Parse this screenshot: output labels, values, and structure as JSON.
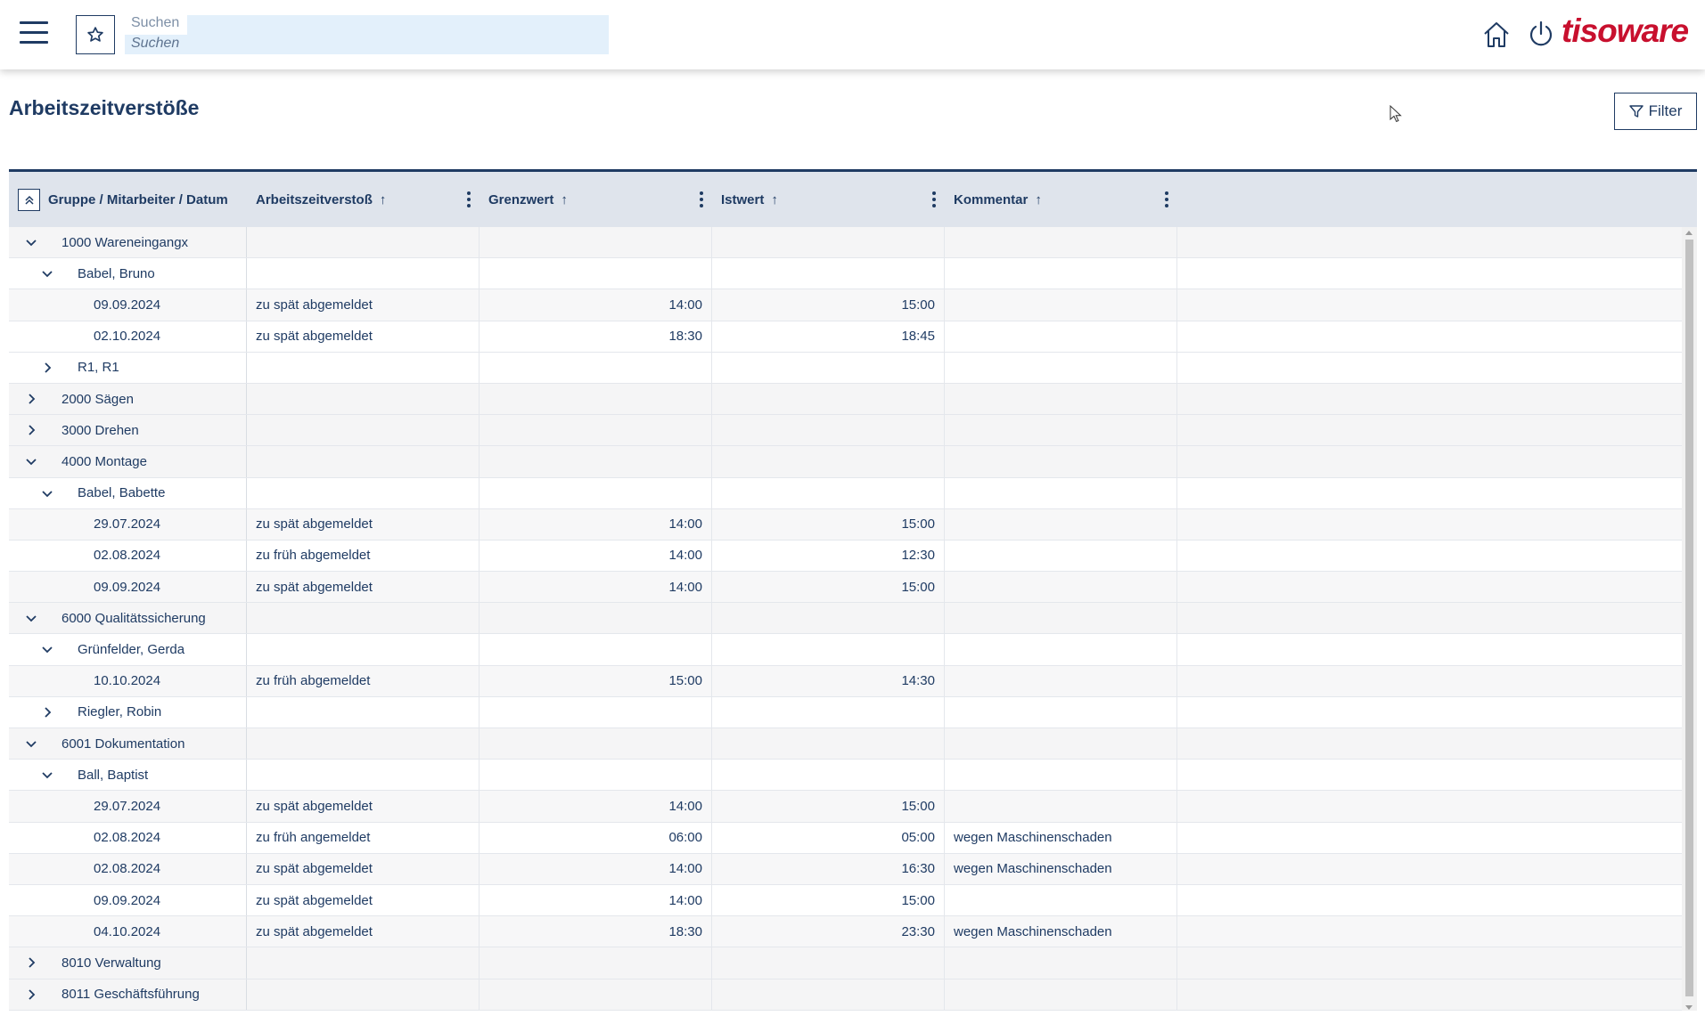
{
  "header": {
    "search_label": "Suchen",
    "search_placeholder": "Suchen",
    "logo": "tisoware",
    "menu_icon": "hamburger-icon",
    "favorite_icon": "star-icon",
    "home_icon": "home-icon",
    "power_icon": "power-icon"
  },
  "page": {
    "title": "Arbeitszeitverstöße",
    "filter_label": "Filter"
  },
  "table": {
    "columns": [
      {
        "label": "Gruppe / Mitarbeiter / Datum"
      },
      {
        "label": "Arbeitszeitverstoß"
      },
      {
        "label": "Grenzwert"
      },
      {
        "label": "Istwert"
      },
      {
        "label": "Kommentar"
      }
    ],
    "rows": [
      {
        "level": 0,
        "expanded": true,
        "label": "1000 Wareneingangx"
      },
      {
        "level": 1,
        "expanded": true,
        "label": "Babel, Bruno"
      },
      {
        "level": 2,
        "label": "09.09.2024",
        "violation": "zu spät abgemeldet",
        "limit": "14:00",
        "actual": "15:00",
        "comment": ""
      },
      {
        "level": 2,
        "label": "02.10.2024",
        "violation": "zu spät abgemeldet",
        "limit": "18:30",
        "actual": "18:45",
        "comment": ""
      },
      {
        "level": 1,
        "expanded": false,
        "label": "R1, R1"
      },
      {
        "level": 0,
        "expanded": false,
        "label": "2000 Sägen"
      },
      {
        "level": 0,
        "expanded": false,
        "label": "3000 Drehen"
      },
      {
        "level": 0,
        "expanded": true,
        "label": "4000 Montage"
      },
      {
        "level": 1,
        "expanded": true,
        "label": "Babel, Babette"
      },
      {
        "level": 2,
        "label": "29.07.2024",
        "violation": "zu spät abgemeldet",
        "limit": "14:00",
        "actual": "15:00",
        "comment": ""
      },
      {
        "level": 2,
        "label": "02.08.2024",
        "violation": "zu früh abgemeldet",
        "limit": "14:00",
        "actual": "12:30",
        "comment": ""
      },
      {
        "level": 2,
        "label": "09.09.2024",
        "violation": "zu spät abgemeldet",
        "limit": "14:00",
        "actual": "15:00",
        "comment": ""
      },
      {
        "level": 0,
        "expanded": true,
        "label": "6000 Qualitätssicherung"
      },
      {
        "level": 1,
        "expanded": true,
        "label": "Grünfelder, Gerda"
      },
      {
        "level": 2,
        "label": "10.10.2024",
        "violation": "zu früh abgemeldet",
        "limit": "15:00",
        "actual": "14:30",
        "comment": ""
      },
      {
        "level": 1,
        "expanded": false,
        "label": "Riegler, Robin"
      },
      {
        "level": 0,
        "expanded": true,
        "label": "6001 Dokumentation"
      },
      {
        "level": 1,
        "expanded": true,
        "label": "Ball, Baptist"
      },
      {
        "level": 2,
        "label": "29.07.2024",
        "violation": "zu spät abgemeldet",
        "limit": "14:00",
        "actual": "15:00",
        "comment": ""
      },
      {
        "level": 2,
        "label": "02.08.2024",
        "violation": "zu früh angemeldet",
        "limit": "06:00",
        "actual": "05:00",
        "comment": "wegen Maschinenschaden"
      },
      {
        "level": 2,
        "label": "02.08.2024",
        "violation": "zu spät abgemeldet",
        "limit": "14:00",
        "actual": "16:30",
        "comment": "wegen Maschinenschaden"
      },
      {
        "level": 2,
        "label": "09.09.2024",
        "violation": "zu spät abgemeldet",
        "limit": "14:00",
        "actual": "15:00",
        "comment": ""
      },
      {
        "level": 2,
        "label": "04.10.2024",
        "violation": "zu spät abgemeldet",
        "limit": "18:30",
        "actual": "23:30",
        "comment": "wegen Maschinenschaden"
      },
      {
        "level": 0,
        "expanded": false,
        "label": "8010 Verwaltung"
      },
      {
        "level": 0,
        "expanded": false,
        "label": "8011 Geschäftsführung"
      }
    ]
  }
}
